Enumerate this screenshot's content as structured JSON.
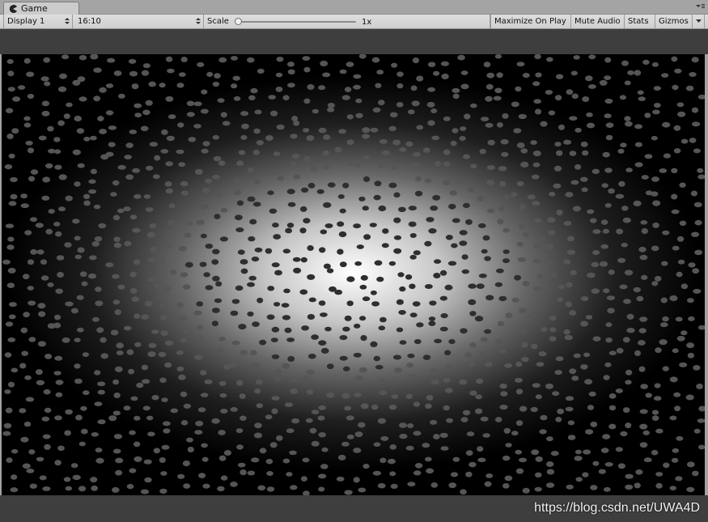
{
  "window": {
    "tab_title": "Game",
    "tab_icon": "pacman-icon"
  },
  "toolbar": {
    "display": "Display 1",
    "aspect": "16:10",
    "scale_label": "Scale",
    "scale_value": "1x",
    "scale_fraction": 0.0,
    "maximize_on_play": "Maximize On Play",
    "mute_audio": "Mute Audio",
    "stats": "Stats",
    "gizmos": "Gizmos"
  },
  "game_view": {
    "background_color": "#000000",
    "glow_color": "#ffffff",
    "dot_color": "#555555"
  },
  "watermark": "https://blog.csdn.net/UWA4D"
}
